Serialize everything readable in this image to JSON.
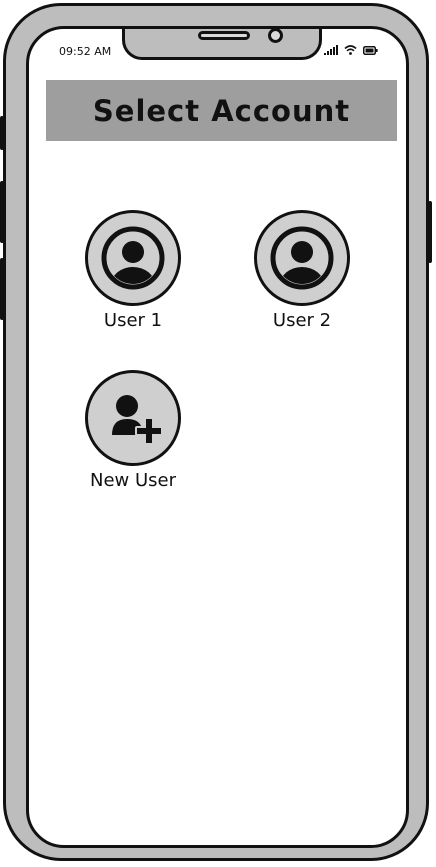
{
  "status_bar": {
    "time": "09:52 AM",
    "icons": [
      "cellular-signal-icon",
      "wifi-icon",
      "battery-icon"
    ]
  },
  "header": {
    "title": "Select Account"
  },
  "accounts": [
    {
      "label": "User 1",
      "icon": "user-profile-icon"
    },
    {
      "label": "User 2",
      "icon": "user-profile-icon"
    },
    {
      "label": "New User",
      "icon": "add-user-icon"
    }
  ],
  "colors": {
    "frame": "#bdbdbd",
    "header_bg": "#9e9e9e",
    "avatar_bg": "#cfcfcf",
    "ink": "#111111",
    "screen_bg": "#ffffff"
  }
}
